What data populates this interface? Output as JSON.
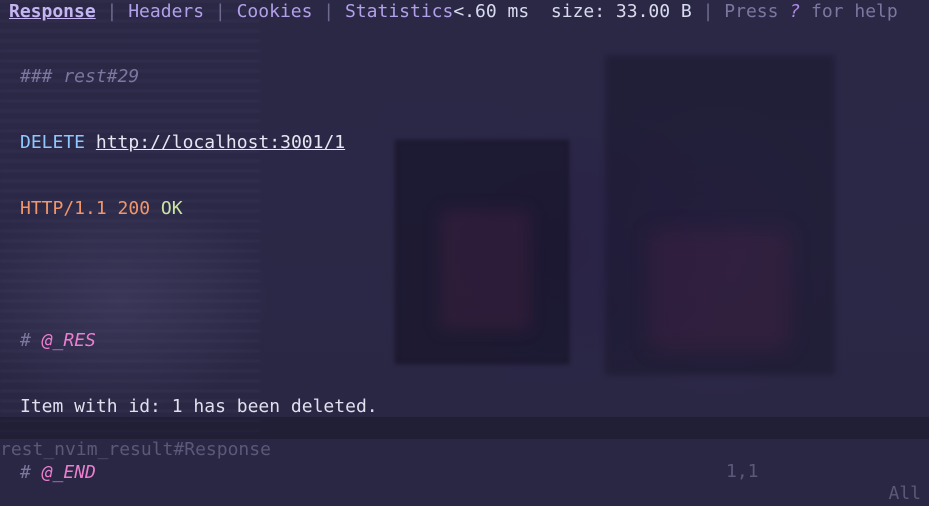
{
  "winbar": {
    "tabs": [
      {
        "label": "Response",
        "active": true
      },
      {
        "label": "Headers",
        "active": false
      },
      {
        "label": "Cookies",
        "active": false
      },
      {
        "label": "Statistics",
        "active": false
      }
    ],
    "separator": " | ",
    "timing": "<.60 ms",
    "size": "size: 33.00 B",
    "help_prefix": "Press ",
    "help_key": "?",
    "help_suffix": " for help"
  },
  "buffer": {
    "heading": "### rest#29",
    "method": "DELETE",
    "url": "http://localhost:3001/1",
    "protocol": "HTTP/1.1 200",
    "status_text": "OK",
    "res_hash": "#",
    "res_marker": "@_RES",
    "body": "Item with id: 1 has been deleted.",
    "end_hash": "#",
    "end_marker": "@_END"
  },
  "statusline": {
    "filename": "rest_nvim_result#Response",
    "position": "1,1",
    "scroll": "All"
  },
  "colors": {
    "background": "#2a2744",
    "tab_active": "#c5b6f3",
    "tab": "#b2a0e8",
    "method": "#8ec8ff",
    "protocol": "#f2966a",
    "status_ok": "#c8e6a0",
    "marker": "#ea7fcf",
    "comment": "#7a77a0"
  }
}
